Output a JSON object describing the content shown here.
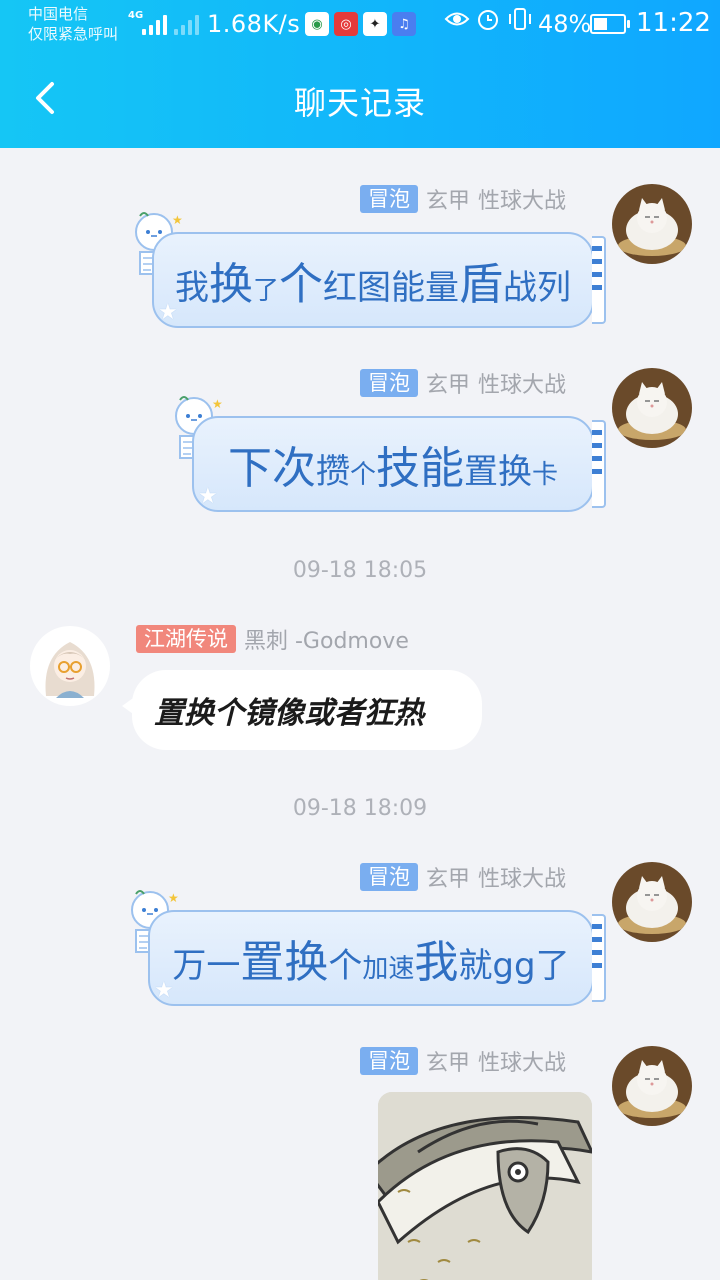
{
  "status_bar": {
    "carrier_line1": "中国电信",
    "carrier_line2": "仅限紧急呼叫",
    "network_label": "4G",
    "net_speed": "1.68K/s",
    "battery": "48%",
    "battery_level": 0.48,
    "time": "11:22",
    "app_icons": [
      "news-app-icon",
      "netease-music-icon",
      "game-app-icon",
      "music-app-icon"
    ],
    "system_icons": [
      "eye-icon",
      "alarm-icon",
      "vibrate-icon"
    ]
  },
  "header": {
    "title": "聊天记录",
    "back_icon": "chevron-left-icon",
    "gradient": [
      "#15c6f5",
      "#10a7ff"
    ]
  },
  "messages": [
    {
      "type": "theme-bubble",
      "tag": "冒泡",
      "name": "玄甲",
      "group": "性球大战",
      "segments": [
        {
          "text": "我",
          "size": "md"
        },
        {
          "text": "换",
          "size": "lg"
        },
        {
          "text": "了",
          "size": "sm"
        },
        {
          "text": "个",
          "size": "lg"
        },
        {
          "text": "红图能量",
          "size": "md"
        },
        {
          "text": "盾",
          "size": "lg"
        },
        {
          "text": "战列",
          "size": "md"
        }
      ]
    },
    {
      "type": "theme-bubble",
      "tag": "冒泡",
      "name": "玄甲",
      "group": "性球大战",
      "segments": [
        {
          "text": "下次",
          "size": "lg"
        },
        {
          "text": "攒",
          "size": "md"
        },
        {
          "text": "个",
          "size": "sm"
        },
        {
          "text": "技能",
          "size": "lg"
        },
        {
          "text": "置换",
          "size": "md"
        },
        {
          "text": "卡",
          "size": "sm"
        }
      ]
    },
    {
      "type": "timestamp",
      "text": "09-18 18:05"
    },
    {
      "type": "plain-bubble",
      "tag": "江湖传说",
      "name": "黑刺 -Godmove",
      "text": "置换个镜像或者狂热"
    },
    {
      "type": "timestamp",
      "text": "09-18 18:09"
    },
    {
      "type": "theme-bubble",
      "tag": "冒泡",
      "name": "玄甲",
      "group": "性球大战",
      "segments": [
        {
          "text": "万一",
          "size": "md"
        },
        {
          "text": "置换",
          "size": "lg"
        },
        {
          "text": "个",
          "size": "md"
        },
        {
          "text": "加速",
          "size": "sm"
        },
        {
          "text": "我",
          "size": "lg"
        },
        {
          "text": "就gg了",
          "size": "md"
        }
      ]
    },
    {
      "type": "image",
      "tag": "冒泡",
      "name": "玄甲",
      "group": "性球大战"
    }
  ],
  "colors": {
    "bubble_text": "#2f6fc2",
    "bubble_border": "#9cc1ee",
    "tag_blue": "#7aaef0",
    "tag_red": "#f1877c",
    "background": "#f2f3f7"
  }
}
